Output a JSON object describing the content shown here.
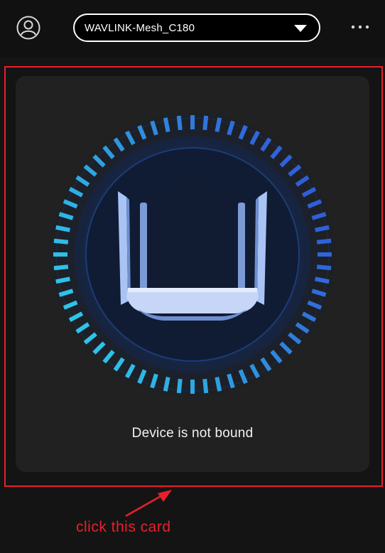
{
  "header": {
    "device_name": "WAVLINK-Mesh_C180"
  },
  "card": {
    "status_text": "Device is not bound"
  },
  "annotation": {
    "text": "click this card",
    "color": "#e8202a"
  },
  "icons": {
    "avatar": "user-circle-icon",
    "dropdown": "triangle-down-icon",
    "more": "more-horizontal-icon"
  },
  "colors": {
    "accent_blue": "#2f6fe0",
    "accent_cyan": "#2ec4e8"
  }
}
